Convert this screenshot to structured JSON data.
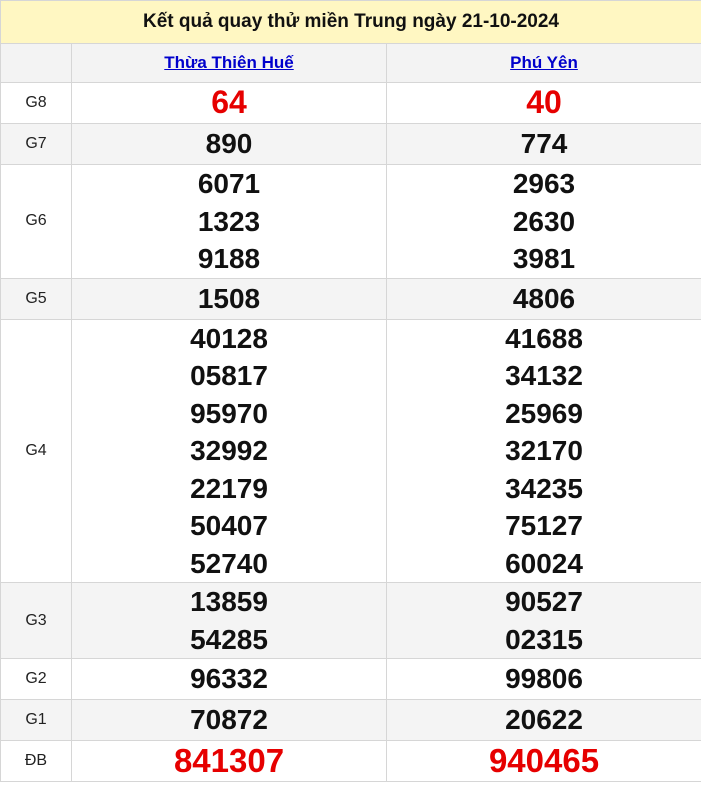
{
  "title": "Kết quả quay thử miền Trung ngày 21-10-2024",
  "provinces": [
    "Thừa Thiên Huế",
    "Phú Yên"
  ],
  "prizes": [
    {
      "label": "G8",
      "results": [
        [
          "64"
        ],
        [
          "40"
        ]
      ]
    },
    {
      "label": "G7",
      "results": [
        [
          "890"
        ],
        [
          "774"
        ]
      ]
    },
    {
      "label": "G6",
      "results": [
        [
          "6071",
          "1323",
          "9188"
        ],
        [
          "2963",
          "2630",
          "3981"
        ]
      ]
    },
    {
      "label": "G5",
      "results": [
        [
          "1508"
        ],
        [
          "4806"
        ]
      ]
    },
    {
      "label": "G4",
      "results": [
        [
          "40128",
          "05817",
          "95970",
          "32992",
          "22179",
          "50407",
          "52740"
        ],
        [
          "41688",
          "34132",
          "25969",
          "32170",
          "34235",
          "75127",
          "60024"
        ]
      ]
    },
    {
      "label": "G3",
      "results": [
        [
          "13859",
          "54285"
        ],
        [
          "90527",
          "02315"
        ]
      ]
    },
    {
      "label": "G2",
      "results": [
        [
          "96332"
        ],
        [
          "99806"
        ]
      ]
    },
    {
      "label": "G1",
      "results": [
        [
          "70872"
        ],
        [
          "20622"
        ]
      ]
    },
    {
      "label": "ĐB",
      "results": [
        [
          "841307"
        ],
        [
          "940465"
        ]
      ]
    }
  ],
  "colors": {
    "header_bg": "#fff7c2",
    "special": "#e60000",
    "link": "#0000cc"
  }
}
